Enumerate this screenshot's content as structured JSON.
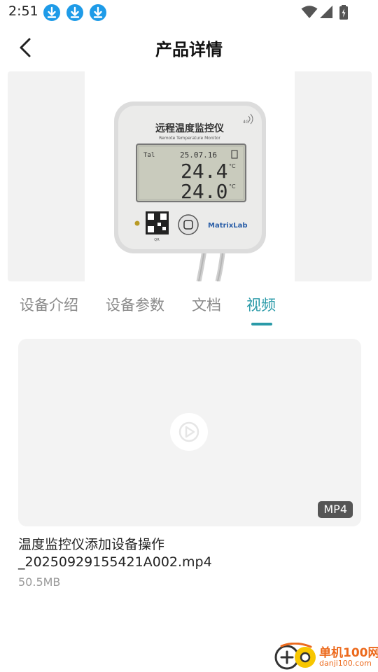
{
  "status_bar": {
    "time": "2:51",
    "notification_icons": [
      "download-icon",
      "download-icon",
      "download-icon"
    ],
    "system_icons": [
      "wifi-icon",
      "signal-icon",
      "battery-charging-icon"
    ]
  },
  "header": {
    "back_icon": "chevron-left-icon",
    "title": "产品详情"
  },
  "product_image": {
    "device_title": "远程温度监控仪",
    "device_subtitle": "Remote Temperature Monitor",
    "network_badge": "4G",
    "lcd_date": "25.07.16",
    "reading_1": "24.4",
    "reading_2": "24.0",
    "unit": "°C",
    "brand": "MatrixLab"
  },
  "tabs": {
    "items": [
      {
        "label": "设备介绍",
        "active": false
      },
      {
        "label": "设备参数",
        "active": false
      },
      {
        "label": "文档",
        "active": false
      },
      {
        "label": "视频",
        "active": true
      }
    ]
  },
  "video": {
    "format": "MP4",
    "file_name": "温度监控仪添加设备操作_20250929155421A002.mp4",
    "file_size": "50.5MB",
    "play_icon": "play-icon"
  },
  "watermark": {
    "name": "单机100网",
    "url": "danji100.com"
  },
  "colors": {
    "accent": "#2a9aa8",
    "download_badge": "#1e9be8",
    "tab_inactive": "#8a8a8a",
    "badge_bg": "#555555",
    "watermark": "#ec6a1d"
  }
}
